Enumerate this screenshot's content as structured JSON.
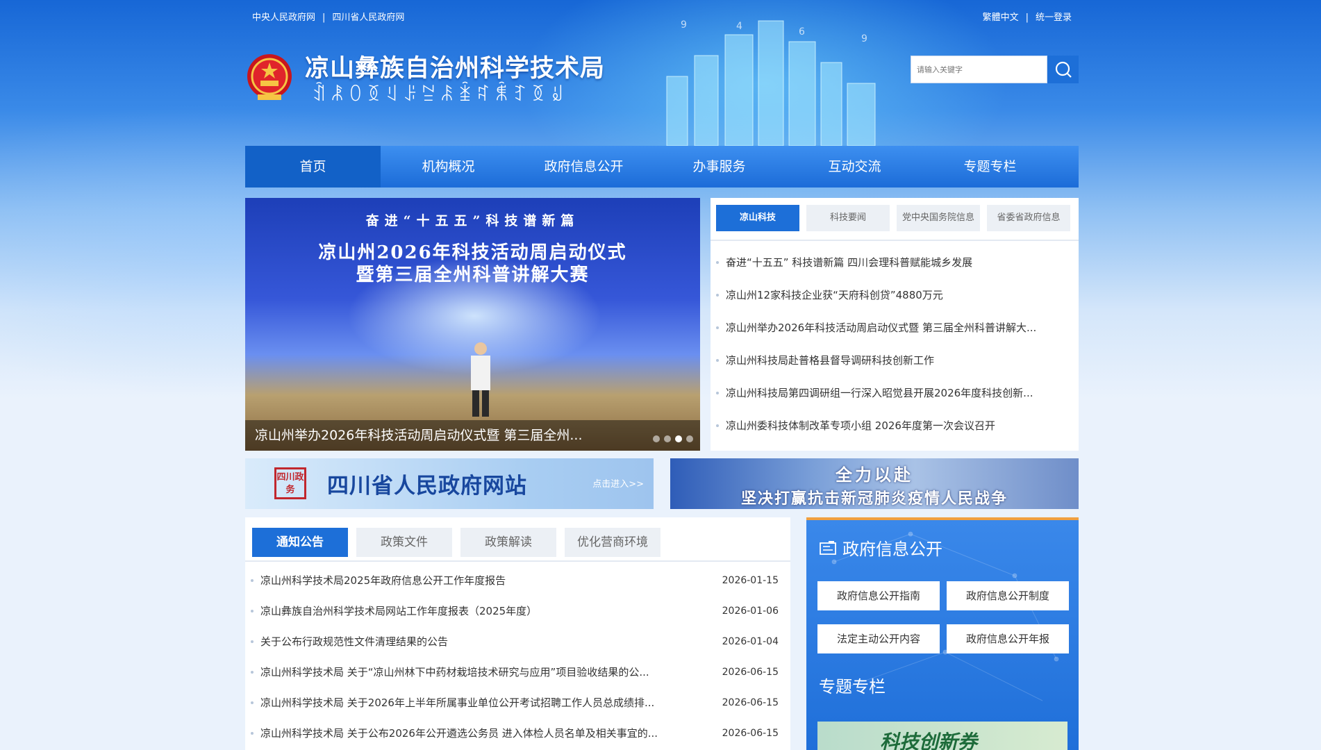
{
  "topbar": {
    "links_left": [
      "中央人民政府网",
      "四川省人民政府网"
    ],
    "sep": "|",
    "lang": "繁體中文",
    "login": "统一登录"
  },
  "brand": {
    "title": "凉山彝族自治州科学技术局",
    "subtitle_yi": "ꀉꂿꄲꅉꆹꌠꊂꄯꁦꉜꐨꆈꅉꆽ"
  },
  "search": {
    "placeholder": "请输入关键字",
    "icon": "search-icon"
  },
  "nav": {
    "items": [
      "首页",
      "机构概况",
      "政府信息公开",
      "办事服务",
      "互动交流",
      "专题专栏"
    ],
    "active": 0
  },
  "slider": {
    "line1": "奋进“十五五”科技谱新篇",
    "line2": "凉山州2026年科技活动周启动仪式",
    "line3": "暨第三届全州科普讲解大赛",
    "caption": "凉山州举办2026年科技活动周启动仪式暨 第三届全州...",
    "dot_count": 4,
    "active_dot": 2
  },
  "news": {
    "tabs": [
      "凉山科技",
      "科技要闻",
      "党中央国务院信息",
      "省委省政府信息"
    ],
    "active_tab": 0,
    "items": [
      "奋进“十五五” 科技谱新篇 四川会理科普赋能城乡发展",
      "凉山州12家科技企业获“天府科创贷”4880万元",
      "凉山州举办2026年科技活动周启动仪式暨 第三届全州科普讲解大...",
      "凉山州科技局赴普格县督导调研科技创新工作",
      "凉山州科技局第四调研组一行深入昭觉县开展2026年度科技创新...",
      "凉山州委科技体制改革专项小组 2026年度第一次会议召开"
    ]
  },
  "banners": {
    "sichuan_seal": "四川政务",
    "sichuan_title": "四川省人民政府网站",
    "sichuan_enter": "点击进入>>",
    "covid_line1": "全力以赴",
    "covid_line2": "坚决打赢抗击新冠肺炎疫情人民战争"
  },
  "notice": {
    "tabs": [
      "通知公告",
      "政策文件",
      "政策解读",
      "优化营商环境"
    ],
    "active_tab": 0,
    "rows": [
      {
        "title": "凉山州科学技术局2025年政府信息公开工作年度报告",
        "date": "2026-01-15"
      },
      {
        "title": "凉山彝族自治州科学技术局网站工作年度报表（2025年度）",
        "date": "2026-01-06"
      },
      {
        "title": "关于公布行政规范性文件清理结果的公告",
        "date": "2026-01-04"
      },
      {
        "title": "凉山州科学技术局 关于“凉山州林下中药材栽培技术研究与应用”项目验收结果的公...",
        "date": "2026-06-15"
      },
      {
        "title": "凉山州科学技术局 关于2026年上半年所属事业单位公开考试招聘工作人员总成绩排...",
        "date": "2026-06-15"
      },
      {
        "title": "凉山州科学技术局 关于公布2026年公开遴选公务员 进入体检人员名单及相关事宜的...",
        "date": "2026-06-15"
      }
    ]
  },
  "gov_info": {
    "heading": "政府信息公开",
    "icon": "document-icon",
    "buttons": [
      "政府信息公开指南",
      "政府信息公开制度",
      "法定主动公开内容",
      "政府信息公开年报"
    ],
    "special_heading": "专题专栏",
    "promo_text": "科技创新券"
  },
  "colors": {
    "primary": "#1d6fd8",
    "nav_active": "#1261c7",
    "accent_orange": "#f0a040"
  }
}
